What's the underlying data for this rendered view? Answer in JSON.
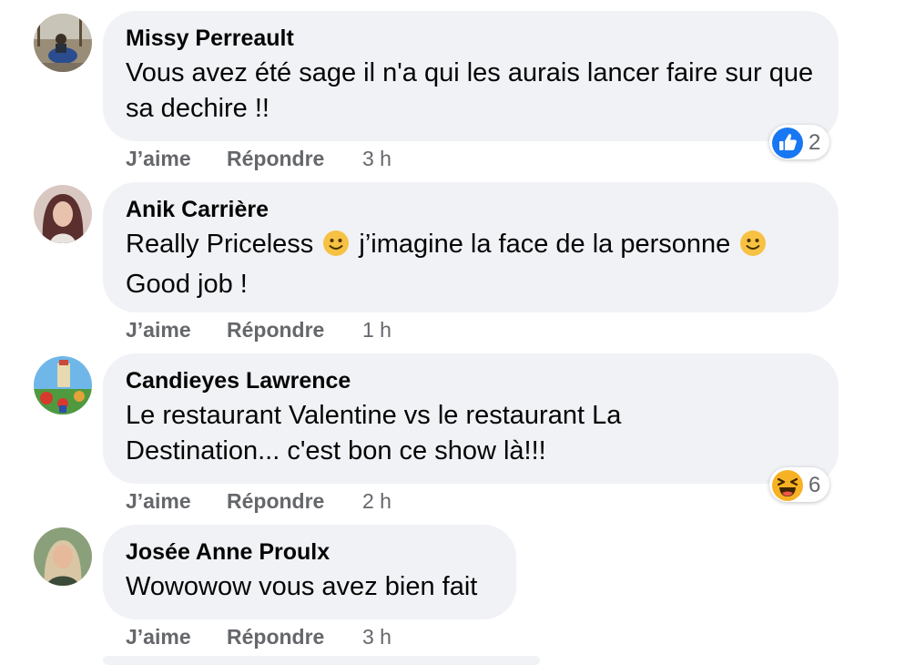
{
  "colors": {
    "bubble": "#f0f2f5",
    "text": "#050505",
    "secondary": "#65676b",
    "like_blue": "#1877f2",
    "haha_yellow": "#f7b125"
  },
  "comments": [
    {
      "author": "Missy Perreault",
      "text": "Vous avez été sage il n'a qui les aurais lancer faire sur que sa dechire !!",
      "like": "J’aime",
      "reply": "Répondre",
      "time": "3 h",
      "reaction_icon": "like-icon",
      "reaction_count": "2"
    },
    {
      "author": "Anik Carrière",
      "text_parts": [
        "Really Priceless ",
        " j’imagine la face de la personne ",
        " Good job !"
      ],
      "like": "J’aime",
      "reply": "Répondre",
      "time": "1 h"
    },
    {
      "author": "Candieyes Lawrence",
      "text": "Le restaurant Valentine vs le restaurant La Destination... c'est bon ce show là!!!",
      "like": "J’aime",
      "reply": "Répondre",
      "time": "2 h",
      "reaction_icon": "haha-icon",
      "reaction_count": "6"
    },
    {
      "author": "Josée Anne Proulx",
      "text": "Wowowow vous avez bien fait",
      "like": "J’aime",
      "reply": "Répondre",
      "time": "3 h"
    }
  ]
}
